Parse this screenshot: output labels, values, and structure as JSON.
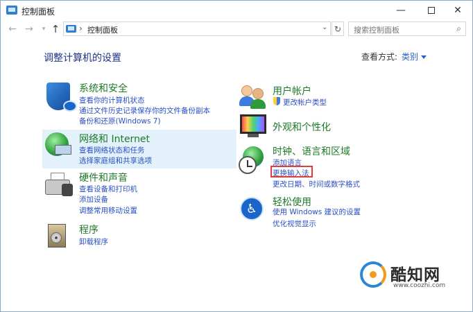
{
  "window": {
    "title": "控制面板",
    "min_glyph": "—",
    "close_glyph": "✕"
  },
  "nav": {
    "back_glyph": "←",
    "forward_glyph": "→",
    "recent_glyph": "▾",
    "up_glyph": "↑",
    "address_sep": "›",
    "address_text": "控制面板",
    "address_dropdown_glyph": "⌄",
    "refresh_glyph": "↻",
    "search_placeholder": "搜索控制面板",
    "search_glyph": "⌕"
  },
  "header": {
    "title": "调整计算机的设置",
    "view_by_label": "查看方式:",
    "view_by_value": "类别"
  },
  "categories": {
    "security": {
      "title": "系统和安全",
      "links": [
        "查看你的计算机状态",
        "通过文件历史记录保存你的文件备份副本",
        "备份和还原(Windows 7)"
      ]
    },
    "network": {
      "title": "网络和 Internet",
      "links": [
        "查看网络状态和任务",
        "选择家庭组和共享选项"
      ]
    },
    "hardware": {
      "title": "硬件和声音",
      "links": [
        "查看设备和打印机",
        "添加设备",
        "调整常用移动设置"
      ]
    },
    "programs": {
      "title": "程序",
      "links": [
        "卸载程序"
      ]
    },
    "accounts": {
      "title": "用户帐户",
      "links": [
        "更改帐户类型"
      ]
    },
    "appearance": {
      "title": "外观和个性化",
      "links": []
    },
    "clock": {
      "title": "时钟、语言和区域",
      "links": [
        "添加语言",
        "更换输入法",
        "更改日期、时间或数字格式"
      ]
    },
    "ease": {
      "title": "轻松使用",
      "links": [
        "使用 Windows 建议的设置",
        "优化视觉显示"
      ]
    }
  },
  "watermark": {
    "brand": "酷知网",
    "url": "www.coozhi.com"
  },
  "colors": {
    "category_title": "#1e7a28",
    "link": "#2a4fc4",
    "heading": "#1e3287",
    "highlight_row": "#e3f1fb",
    "annotation_box": "#e23b3b"
  }
}
